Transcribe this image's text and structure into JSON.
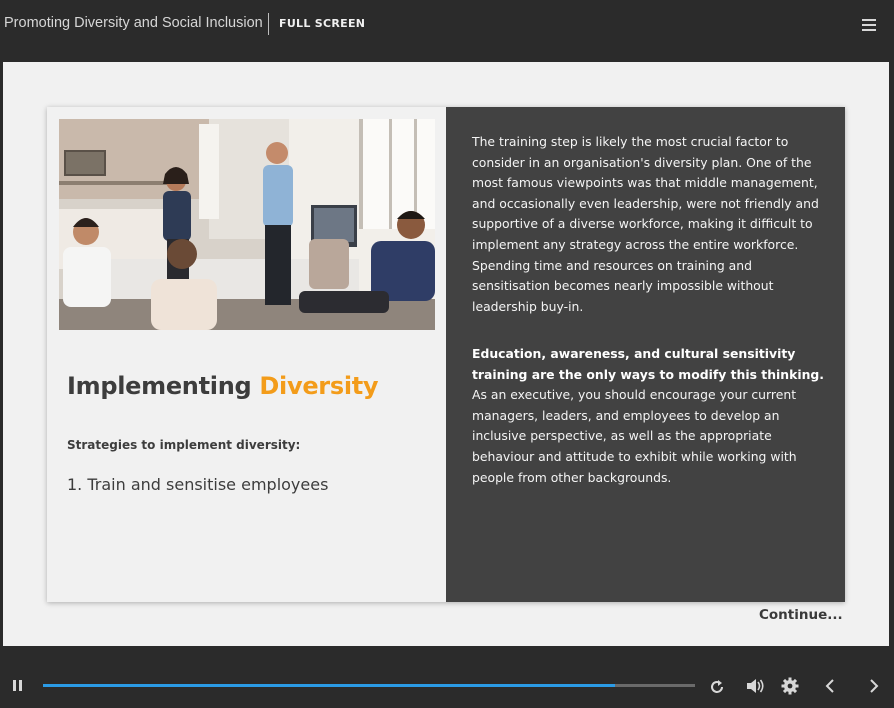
{
  "header": {
    "course_title": "Promoting Diversity and Social Inclusion",
    "fullscreen_label": "FULL SCREEN",
    "menu_icon": "hamburger-menu-icon"
  },
  "slide": {
    "image_alt": "Team meeting in an office",
    "heading_part1": "Implementing ",
    "heading_part2": "Diversity",
    "heading_accent_color": "#f39c1a",
    "strategies_label": "Strategies to implement diversity:",
    "strategy_item": "1. Train and sensitise employees",
    "paragraph1": "The training step is likely the most crucial factor to consider in an organisation's diversity plan. One of the most famous viewpoints was that middle management, and occasionally even leadership, were not friendly and supportive of a diverse workforce, making it difficult to implement any strategy across the entire workforce. Spending time and resources on training and sensitisation becomes nearly impossible without leadership buy-in.",
    "paragraph2_bold": "Education, awareness, and cultural sensitivity training are the only ways to modify this thinking.",
    "paragraph2_rest": " As an executive, you should encourage your current managers, leaders, and employees to develop an inclusive perspective, as well as the appropriate behaviour and attitude to exhibit while working with people from other backgrounds.",
    "continue_label": "Continue..."
  },
  "player": {
    "progress_fraction": 0.877,
    "progress_color": "#2b9be6",
    "icons": [
      "pause-icon",
      "replay-icon",
      "volume-icon",
      "settings-gear-icon",
      "previous-chevron-icon",
      "next-chevron-icon"
    ]
  }
}
